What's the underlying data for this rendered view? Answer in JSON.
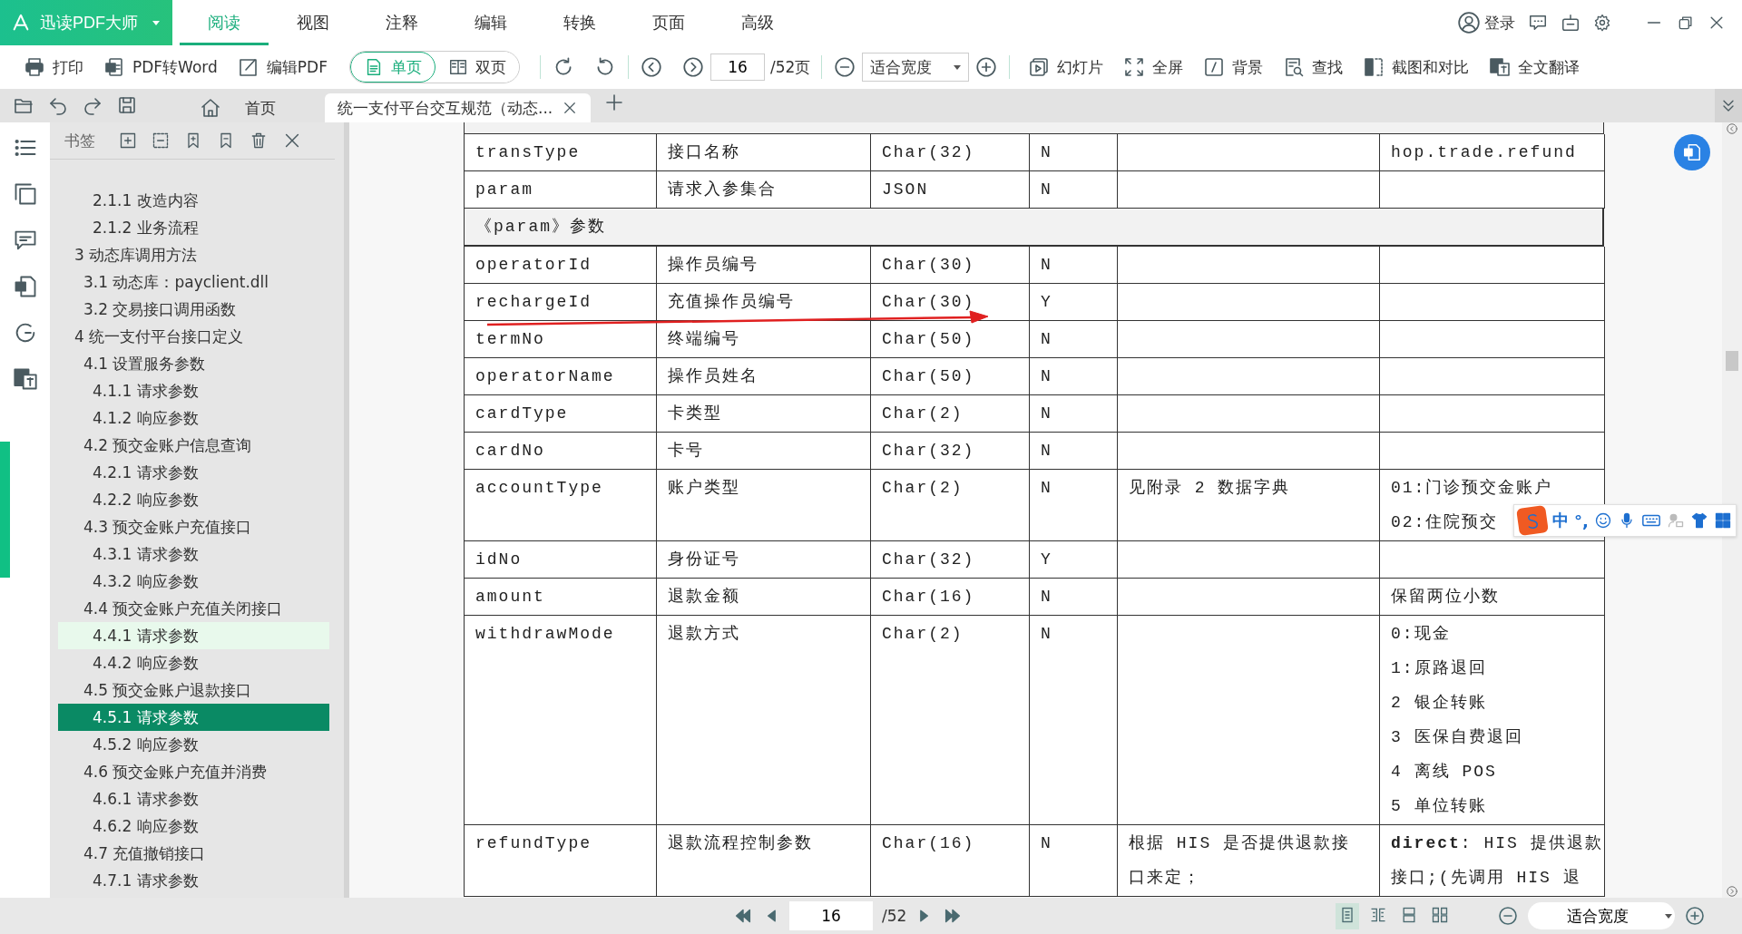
{
  "app": {
    "title": "迅读PDF大师"
  },
  "menu_tabs": [
    {
      "label": "阅读",
      "selected": true
    },
    {
      "label": "视图",
      "selected": false
    },
    {
      "label": "注释",
      "selected": false
    },
    {
      "label": "编辑",
      "selected": false
    },
    {
      "label": "转换",
      "selected": false
    },
    {
      "label": "页面",
      "selected": false
    },
    {
      "label": "高级",
      "selected": false
    }
  ],
  "account": {
    "login": "登录"
  },
  "toolbar": {
    "actions_left": [
      {
        "label": "打印"
      },
      {
        "label": "PDF转Word"
      },
      {
        "label": "编辑PDF"
      }
    ],
    "view_modes": [
      {
        "label": "单页",
        "selected": true
      },
      {
        "label": "双页",
        "selected": false
      }
    ],
    "page_field": {
      "value": "16"
    },
    "page_total": "/52页",
    "zoom_dropdown": {
      "value": "适合宽度"
    },
    "actions_right": [
      {
        "label": "幻灯片"
      },
      {
        "label": "全屏"
      },
      {
        "label": "背景"
      },
      {
        "label": "查找"
      },
      {
        "label": "截图和对比"
      },
      {
        "label": "全文翻译"
      }
    ]
  },
  "doc_tabs": [
    {
      "kind": "home",
      "label": "首页",
      "selected": false
    },
    {
      "kind": "document",
      "label": "统一支付平台交互规范（动态...",
      "selected": true
    }
  ],
  "bookmarks": {
    "title": "书签",
    "outline": [
      {
        "children": [
          {
            "children": [
              {
                "label": "2.1.1 改造内容",
                "selected": false,
                "hovered": false
              },
              {
                "label": "2.1.2 业务流程",
                "selected": false,
                "hovered": false
              }
            ]
          }
        ]
      },
      {
        "label": "3 动态库调用方法",
        "selected": false,
        "hovered": false,
        "children": [
          {
            "label": "3.1 动态库：payclient.dll",
            "selected": false,
            "hovered": false
          },
          {
            "label": "3.2 交易接口调用函数",
            "selected": false,
            "hovered": false
          }
        ]
      },
      {
        "label": "4 统一支付平台接口定义",
        "selected": false,
        "hovered": false,
        "children": [
          {
            "label": "4.1 设置服务参数",
            "selected": false,
            "hovered": false,
            "children": [
              {
                "label": "4.1.1 请求参数",
                "selected": false,
                "hovered": false
              },
              {
                "label": "4.1.2 响应参数",
                "selected": false,
                "hovered": false
              }
            ]
          },
          {
            "label": "4.2 预交金账户信息查询",
            "selected": false,
            "hovered": false,
            "children": [
              {
                "label": "4.2.1 请求参数",
                "selected": false,
                "hovered": false
              },
              {
                "label": "4.2.2 响应参数",
                "selected": false,
                "hovered": false
              }
            ]
          },
          {
            "label": "4.3 预交金账户充值接口",
            "selected": false,
            "hovered": false,
            "children": [
              {
                "label": "4.3.1 请求参数",
                "selected": false,
                "hovered": false
              },
              {
                "label": "4.3.2 响应参数",
                "selected": false,
                "hovered": false
              }
            ]
          },
          {
            "label": "4.4 预交金账户充值关闭接口",
            "selected": false,
            "hovered": false,
            "children": [
              {
                "label": "4.4.1 请求参数",
                "selected": false,
                "hovered": true
              },
              {
                "label": "4.4.2 响应参数",
                "selected": false,
                "hovered": false
              }
            ]
          },
          {
            "label": "4.5 预交金账户退款接口",
            "selected": false,
            "hovered": false,
            "children": [
              {
                "label": "4.5.1 请求参数",
                "selected": true,
                "hovered": false
              },
              {
                "label": "4.5.2 响应参数",
                "selected": false,
                "hovered": false
              }
            ]
          },
          {
            "label": "4.6 预交金账户充值并消费",
            "selected": false,
            "hovered": false,
            "children": [
              {
                "label": "4.6.1 请求参数",
                "selected": false,
                "hovered": false
              },
              {
                "label": "4.6.2 响应参数",
                "selected": false,
                "hovered": false
              }
            ]
          },
          {
            "label": "4.7 充值撤销接口",
            "selected": false,
            "hovered": false,
            "children": [
              {
                "label": "4.7.1 请求参数",
                "selected": false,
                "hovered": false
              }
            ]
          }
        ]
      }
    ]
  },
  "table": {
    "rows": [
      {
        "kind": "data",
        "cells": [
          "transType",
          "接口名称",
          "Char(32)",
          "N",
          "",
          "hop.trade.refund"
        ]
      },
      {
        "kind": "data",
        "cells": [
          "param",
          "请求入参集合",
          "JSON",
          "N",
          "",
          ""
        ]
      },
      {
        "kind": "section",
        "cells": [
          "《param》参数"
        ]
      },
      {
        "kind": "data",
        "cells": [
          "operatorId",
          "操作员编号",
          "Char(30)",
          "N",
          "",
          ""
        ]
      },
      {
        "kind": "data",
        "cells": [
          "rechargeId",
          "充值操作员编号",
          "Char(30)",
          "Y",
          "",
          ""
        ]
      },
      {
        "kind": "data",
        "cells": [
          "termNo",
          "终端编号",
          "Char(50)",
          "N",
          "",
          ""
        ]
      },
      {
        "kind": "data",
        "cells": [
          "operatorName",
          "操作员姓名",
          "Char(50)",
          "N",
          "",
          ""
        ]
      },
      {
        "kind": "data",
        "cells": [
          "cardType",
          "卡类型",
          "Char(2)",
          "N",
          "",
          ""
        ]
      },
      {
        "kind": "data",
        "cells": [
          "cardNo",
          "卡号",
          "Char(32)",
          "N",
          "",
          ""
        ]
      },
      {
        "kind": "data",
        "cells": [
          "accountType",
          "账户类型",
          "Char(2)",
          "N",
          "见附录 2 数据字典",
          [
            "01:门诊预交金账户",
            "02:住院预交"
          ]
        ]
      },
      {
        "kind": "data",
        "cells": [
          "idNo",
          "身份证号",
          "Char(32)",
          "Y",
          "",
          ""
        ]
      },
      {
        "kind": "data",
        "cells": [
          "amount",
          "退款金额",
          "Char(16)",
          "N",
          "",
          "保留两位小数"
        ]
      },
      {
        "kind": "data",
        "cells": [
          "withdrawMode",
          "退款方式",
          "Char(2)",
          "N",
          "",
          [
            "0:现金",
            "1:原路退回",
            "2 银企转账",
            "3 医保自费退回",
            "4 离线 POS",
            "5 单位转账"
          ]
        ]
      },
      {
        "kind": "data",
        "cells": [
          "refundType",
          "退款流程控制参数",
          "Char(16)",
          "N",
          [
            "根据 HIS 是否提供退款接",
            "口来定；"
          ],
          [
            "**direct**: HIS 提供退款",
            "接口;(先调用 HIS 退"
          ]
        ]
      }
    ]
  },
  "ime_toolbar": {
    "mode": "中",
    "punct": "°,"
  },
  "status_bar": {
    "page_field": {
      "value": "16"
    },
    "page_total": "/52",
    "view_modes": [
      {
        "selected": true
      },
      {
        "selected": false
      },
      {
        "selected": false
      },
      {
        "selected": false
      }
    ],
    "zoom_dropdown": {
      "value": "适合宽度"
    }
  }
}
